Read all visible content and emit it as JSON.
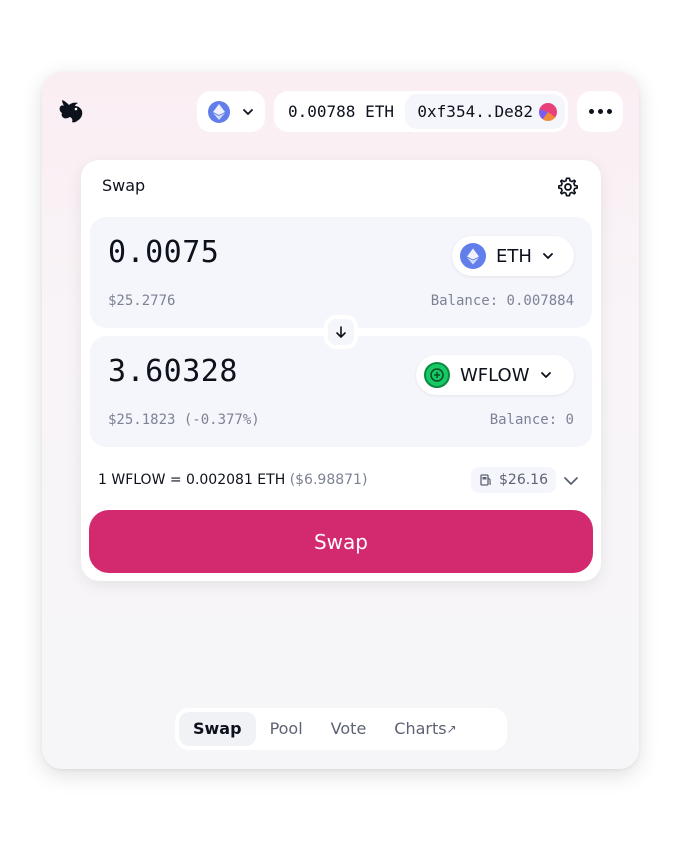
{
  "header": {
    "network": "Ethereum",
    "eth_balance": "0.00788 ETH",
    "address": "0xf354..De82"
  },
  "swap_card": {
    "title": "Swap",
    "input": {
      "amount": "0.0075",
      "token": "ETH",
      "usd_value": "$25.2776",
      "balance": "Balance: 0.007884"
    },
    "output": {
      "amount": "3.60328",
      "token": "WFLOW",
      "usd_value": "$25.1823 (-0.377%)",
      "balance": "Balance: 0"
    },
    "rate": "1 WFLOW = 0.002081 ETH",
    "rate_usd": "($6.98871)",
    "gas_fee": "$26.16",
    "submit_label": "Swap"
  },
  "nav": {
    "items": [
      {
        "label": "Swap",
        "active": true
      },
      {
        "label": "Pool",
        "active": false
      },
      {
        "label": "Vote",
        "active": false
      },
      {
        "label": "Charts",
        "active": false,
        "external": true
      }
    ]
  },
  "colors": {
    "accent": "#d3296e",
    "eth": "#627eea",
    "wflow": "#17c964"
  }
}
